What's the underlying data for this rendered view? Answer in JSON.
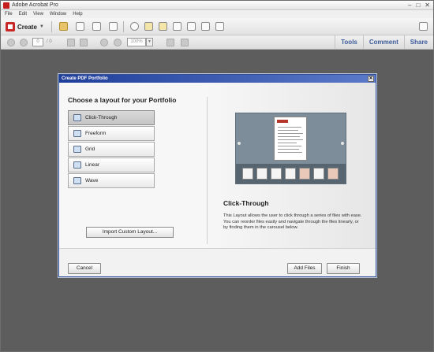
{
  "app": {
    "title": "Adobe Acrobat Pro",
    "window_controls": [
      "–",
      "□",
      "✕"
    ]
  },
  "menu": [
    "File",
    "Edit",
    "View",
    "Window",
    "Help"
  ],
  "toolbar": {
    "create_label": "Create",
    "page_value": "0",
    "page_of": "/ 0",
    "zoom_value": "100%",
    "nav": [
      "Tools",
      "Comment",
      "Share"
    ]
  },
  "dialog": {
    "title": "Create PDF Portfolio",
    "close": "✕",
    "heading": "Choose a layout for your Portfolio",
    "layouts": [
      {
        "label": "Click-Through",
        "selected": true
      },
      {
        "label": "Freeform",
        "selected": false
      },
      {
        "label": "Grid",
        "selected": false
      },
      {
        "label": "Linear",
        "selected": false
      },
      {
        "label": "Wave",
        "selected": false
      }
    ],
    "import_button": "Import Custom Layout...",
    "layout_name": "Click-Through",
    "layout_description": "This Layout allows the user to click through a series of files with ease. You can reorder files easily and navigate through the files linearly, or by finding them in the carousel below.",
    "buttons": {
      "cancel": "Cancel",
      "add_files": "Add Files",
      "finish": "Finish"
    }
  },
  "colors": {
    "accent": "#3c5b9a",
    "dialog_title_bar": "#1f3e9a",
    "workspace": "#5d5d5d"
  }
}
